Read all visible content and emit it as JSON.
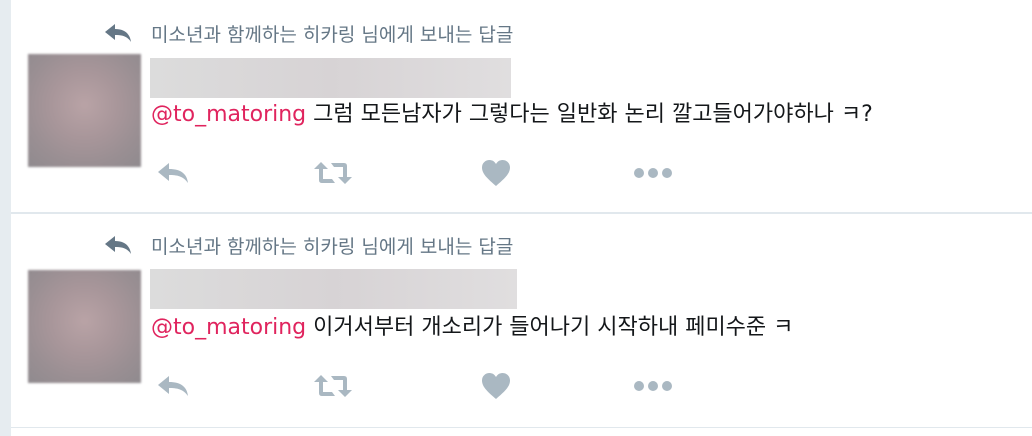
{
  "tweets": [
    {
      "context": "미소년과 함께하는 히카링 님에게 보내는 답글",
      "mention": "@to_matoring",
      "text": " 그럼 모든남자가 그렇다는 일반화 논리 깔고들어가야하나 ㅋ?"
    },
    {
      "context": "미소년과 함께하는 히카링 님에게 보내는 답글",
      "mention": "@to_matoring",
      "text": " 이거서부터 개소리가 들어나기 시작하내 페미수준 ㅋ"
    }
  ],
  "icons": {
    "context": "reply-arrow-icon",
    "reply": "reply-icon",
    "retweet": "retweet-icon",
    "like": "heart-icon",
    "more": "more-dots-icon"
  },
  "colors": {
    "mention": "#e0245e",
    "context_text": "#657786",
    "icon": "#aab8c2",
    "divider": "#e1e8ed"
  }
}
